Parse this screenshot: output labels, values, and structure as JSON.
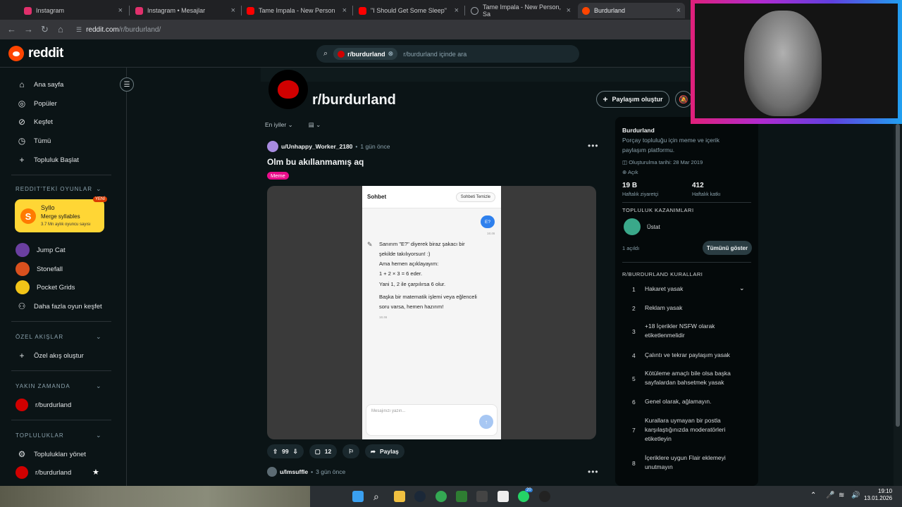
{
  "browser": {
    "tabs": [
      {
        "title": "Instagram",
        "color": "#e1306c"
      },
      {
        "title": "Instagram • Mesajlar",
        "color": "#e1306c"
      },
      {
        "title": "Tame Impala - New Person",
        "color": "#ff0000"
      },
      {
        "title": "\"I Should Get Some Sleep\"",
        "color": "#ff0000"
      },
      {
        "title": "Tame Impala - New Person, Sa",
        "color": "#9aa0a6"
      },
      {
        "title": "Burdurland",
        "color": "#ff4500"
      }
    ],
    "url_host": "reddit.com",
    "url_path": "/r/burdurland/"
  },
  "header": {
    "logo_text": "reddit",
    "search_chip": "r/burdurland",
    "search_placeholder": "r/burdurland içinde ara"
  },
  "sidebar": {
    "main": [
      "Ana sayfa",
      "Popüler",
      "Keşfet",
      "Tümü"
    ],
    "start_community": "Topluluk Başlat",
    "games_section": "REDDIT'TEKİ OYUNLAR",
    "featured_game": {
      "name": "Syllo",
      "tagline": "Merge syllables",
      "stats": "3.7 Mn aylık oyuncu sayısı",
      "badge": "YENİ"
    },
    "games": [
      "Jump Cat",
      "Stonefall",
      "Pocket Grids"
    ],
    "more_games": "Daha fazla oyun keşfet",
    "custom_feeds_section": "ÖZEL AKIŞLAR",
    "create_feed": "Özel akış oluştur",
    "recent_section": "YAKIN ZAMANDA",
    "recent": [
      "r/burdurland"
    ],
    "communities_section": "TOPLULUKLAR",
    "manage_communities": "Toplulukları yönet",
    "communities": [
      "r/burdurland"
    ]
  },
  "subreddit": {
    "name": "r/burdurland",
    "create_post": "Paylaşım oluştur",
    "sort": "En iyiler"
  },
  "posts": [
    {
      "user": "u/Unhappy_Worker_2180",
      "time": "1 gün önce",
      "title": "Olm bu akıllanmamış aq",
      "flair": "Meme",
      "votes": "99",
      "comments": "12",
      "share": "Paylaş",
      "screenshot": {
        "title": "Sohbet",
        "clear_button": "Sohbeti Temizle",
        "user_msg": "E?",
        "user_time": "16:46",
        "reply_lines": [
          "Sanırım \"E?\" diyerek biraz şakacı bir",
          "şekilde takılıyorsun! :)",
          "Ama hemen açıklayayım:",
          "1 + 2 × 3 = 6 eder.",
          "Yani 1, 2 ile çarpılırsa 6 olur."
        ],
        "reply_lines2": [
          "Başka bir matematik işlemi veya eğlenceli",
          "soru varsa, hemen hazırım!"
        ],
        "reply_time": "16:46",
        "input_placeholder": "Mesajınızı yazın..."
      }
    },
    {
      "user": "u/lmsuffle",
      "time": "3 gün önce"
    }
  ],
  "about": {
    "title": "Burdurland",
    "description_1": "Porçay topluluğu için meme ve içerik",
    "description_2": "paylaşım platformu.",
    "created": "Oluşturulma tarihi: 28 Mar 2019",
    "visibility": "Açık",
    "weekly_visitors": "19 B",
    "weekly_visitors_label": "Haftalık ziyaretçi",
    "weekly_contrib": "412",
    "weekly_contrib_label": "Haftalık katkı",
    "achievements_title": "TOPLULUK KAZANIMLARI",
    "achievement": "Üstat",
    "unlocked": "1 açıldı",
    "show_all": "Tümünü göster",
    "rules_title": "R/BURDURLAND KURALLARI",
    "rules": [
      "Hakaret yasak",
      "Reklam yasak",
      "+18 İçerikler NSFW olarak etiketlenmelidir",
      "Çalıntı ve tekrar paylaşım yasak",
      "Kötüleme amaçlı bile olsa başka sayfalardan bahsetmek yasak",
      "Genel olarak, ağlamayın.",
      "Kurallara uymayan bir postla karşılaştığınızda moderatörleri etiketleyin",
      "İçeriklere uygun Flair eklemeyi unutmayın"
    ]
  },
  "taskbar": {
    "time": "19:10",
    "date": "13.01.2026",
    "whatsapp_badge": "20"
  },
  "colors": {
    "accent": "#ff4500",
    "flair": "#ea0e8b",
    "bg": "#0b1416"
  }
}
